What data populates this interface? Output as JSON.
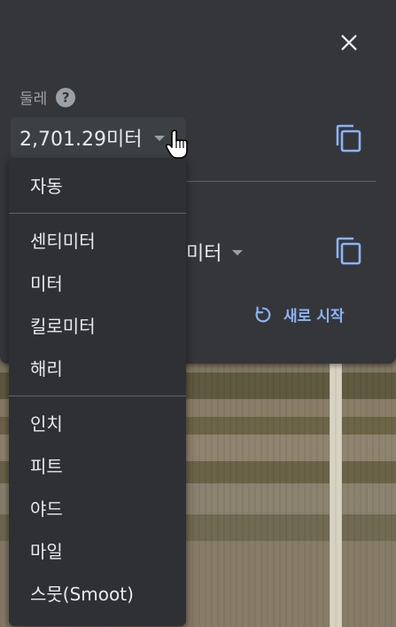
{
  "panel": {
    "field_label": "둘레",
    "help_icon": "help-circle-icon",
    "perimeter_value": "2,701.29미터",
    "area_unit": "미터",
    "restart_label": "새로 시작",
    "icons": {
      "close": "close-icon",
      "copy": "copy-icon",
      "restart": "restart-icon",
      "caret": "caret-down-icon"
    }
  },
  "dropdown": {
    "groups": [
      [
        "자동"
      ],
      [
        "센티미터",
        "미터",
        "킬로미터",
        "해리"
      ],
      [
        "인치",
        "피트",
        "야드",
        "마일",
        "스뭇(Smoot)"
      ]
    ],
    "items": [
      "자동",
      "센티미터",
      "미터",
      "킬로미터",
      "해리",
      "인치",
      "피트",
      "야드",
      "마일",
      "스뭇(Smoot)"
    ]
  },
  "colors": {
    "panel_bg": "#35363a",
    "menu_bg": "#2f3033",
    "accent": "#8ab4f8",
    "text": "#e8eaed",
    "muted": "#9aa0a6"
  }
}
